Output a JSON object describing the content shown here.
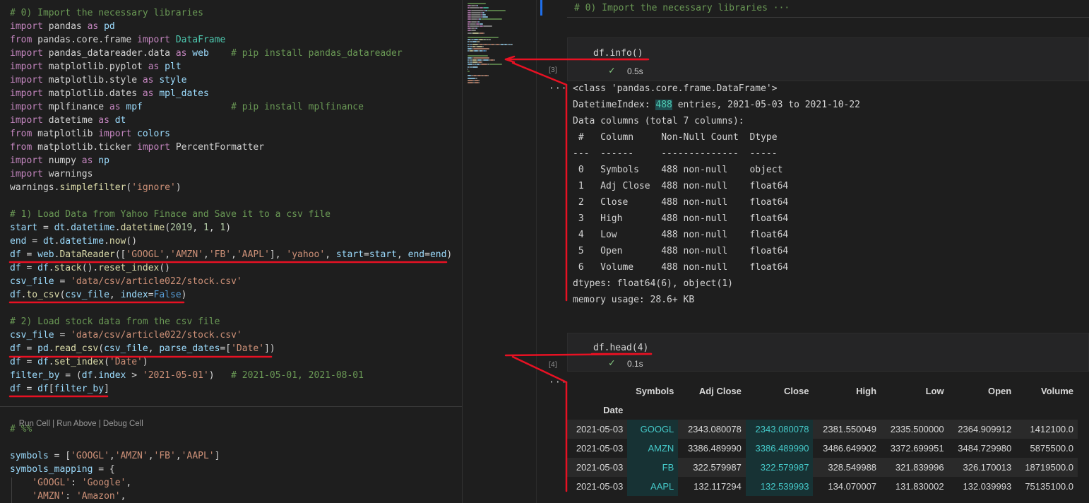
{
  "editor": {
    "lines": [
      [
        [
          "# 0) Import the necessary libraries",
          "cm"
        ]
      ],
      [
        [
          "import",
          "kw"
        ],
        [
          " pandas ",
          "def"
        ],
        [
          "as",
          "kw"
        ],
        [
          " pd",
          "var"
        ]
      ],
      [
        [
          "from",
          "kw"
        ],
        [
          " pandas.core.frame ",
          "def"
        ],
        [
          "import",
          "kw"
        ],
        [
          " DataFrame",
          "mod"
        ]
      ],
      [
        [
          "import",
          "kw"
        ],
        [
          " pandas_datareader.data ",
          "def"
        ],
        [
          "as",
          "kw"
        ],
        [
          " web",
          "var"
        ],
        [
          "    # pip install pandas_datareader",
          "cm"
        ]
      ],
      [
        [
          "import",
          "kw"
        ],
        [
          " matplotlib.pyplot ",
          "def"
        ],
        [
          "as",
          "kw"
        ],
        [
          " plt",
          "var"
        ]
      ],
      [
        [
          "import",
          "kw"
        ],
        [
          " matplotlib.style ",
          "def"
        ],
        [
          "as",
          "kw"
        ],
        [
          " style",
          "var"
        ]
      ],
      [
        [
          "import",
          "kw"
        ],
        [
          " matplotlib.dates ",
          "def"
        ],
        [
          "as",
          "kw"
        ],
        [
          " mpl_dates",
          "var"
        ]
      ],
      [
        [
          "import",
          "kw"
        ],
        [
          " mplfinance ",
          "def"
        ],
        [
          "as",
          "kw"
        ],
        [
          " mpf",
          "var"
        ],
        [
          "                # pip install mplfinance",
          "cm"
        ]
      ],
      [
        [
          "import",
          "kw"
        ],
        [
          " datetime ",
          "def"
        ],
        [
          "as",
          "kw"
        ],
        [
          " dt",
          "var"
        ]
      ],
      [
        [
          "from",
          "kw"
        ],
        [
          " matplotlib ",
          "def"
        ],
        [
          "import",
          "kw"
        ],
        [
          " colors",
          "var"
        ]
      ],
      [
        [
          "from",
          "kw"
        ],
        [
          " matplotlib.ticker ",
          "def"
        ],
        [
          "import",
          "kw"
        ],
        [
          " PercentFormatter",
          "def"
        ]
      ],
      [
        [
          "import",
          "kw"
        ],
        [
          " numpy ",
          "def"
        ],
        [
          "as",
          "kw"
        ],
        [
          " np",
          "var"
        ]
      ],
      [
        [
          "import",
          "kw"
        ],
        [
          " warnings",
          "def"
        ]
      ],
      [
        [
          "warnings",
          "def"
        ],
        [
          ".",
          "def"
        ],
        [
          "simplefilter",
          "fn"
        ],
        [
          "(",
          "def"
        ],
        [
          "'ignore'",
          "str"
        ],
        [
          ")",
          "def"
        ]
      ],
      [],
      [
        [
          "# 1) Load Data from Yahoo Finace and Save it to a csv file",
          "cm"
        ]
      ],
      [
        [
          "start",
          "var"
        ],
        [
          " = ",
          "def"
        ],
        [
          "dt",
          "var"
        ],
        [
          ".",
          "def"
        ],
        [
          "datetime",
          "var"
        ],
        [
          ".",
          "def"
        ],
        [
          "datetime",
          "fn"
        ],
        [
          "(",
          "def"
        ],
        [
          "2019",
          "num"
        ],
        [
          ", ",
          "def"
        ],
        [
          "1",
          "num"
        ],
        [
          ", ",
          "def"
        ],
        [
          "1",
          "num"
        ],
        [
          ")",
          "def"
        ]
      ],
      [
        [
          "end",
          "var"
        ],
        [
          " = ",
          "def"
        ],
        [
          "dt",
          "var"
        ],
        [
          ".",
          "def"
        ],
        [
          "datetime",
          "var"
        ],
        [
          ".",
          "def"
        ],
        [
          "now",
          "fn"
        ],
        [
          "()",
          "def"
        ]
      ],
      [
        [
          "df",
          "var"
        ],
        [
          " = ",
          "def"
        ],
        [
          "web",
          "var"
        ],
        [
          ".",
          "def"
        ],
        [
          "DataReader",
          "fn"
        ],
        [
          "([",
          "def"
        ],
        [
          "'GOOGL'",
          "str"
        ],
        [
          ",",
          "def"
        ],
        [
          "'AMZN'",
          "str"
        ],
        [
          ",",
          "def"
        ],
        [
          "'FB'",
          "str"
        ],
        [
          ",",
          "def"
        ],
        [
          "'AAPL'",
          "str"
        ],
        [
          "], ",
          "def"
        ],
        [
          "'yahoo'",
          "str"
        ],
        [
          ", ",
          "def"
        ],
        [
          "start",
          "var"
        ],
        [
          "=",
          "def"
        ],
        [
          "start",
          "var"
        ],
        [
          ", ",
          "def"
        ],
        [
          "end",
          "var"
        ],
        [
          "=",
          "def"
        ],
        [
          "end",
          "var"
        ],
        [
          ")",
          "def"
        ]
      ],
      [
        [
          "df",
          "var"
        ],
        [
          " = ",
          "def"
        ],
        [
          "df",
          "var"
        ],
        [
          ".",
          "def"
        ],
        [
          "stack",
          "fn"
        ],
        [
          "().",
          "def"
        ],
        [
          "reset_index",
          "fn"
        ],
        [
          "()",
          "def"
        ]
      ],
      [
        [
          "csv_file",
          "var"
        ],
        [
          " = ",
          "def"
        ],
        [
          "'data/csv/article022/stock.csv'",
          "str"
        ]
      ],
      [
        [
          "df",
          "var"
        ],
        [
          ".",
          "def"
        ],
        [
          "to_csv",
          "fn"
        ],
        [
          "(",
          "def"
        ],
        [
          "csv_file",
          "var"
        ],
        [
          ", ",
          "def"
        ],
        [
          "index",
          "var"
        ],
        [
          "=",
          "def"
        ],
        [
          "False",
          "bool"
        ],
        [
          ")",
          "def"
        ]
      ],
      [],
      [
        [
          "# 2) Load stock data from the csv file",
          "cm"
        ]
      ],
      [
        [
          "csv_file",
          "var"
        ],
        [
          " = ",
          "def"
        ],
        [
          "'data/csv/article022/stock.csv'",
          "str"
        ]
      ],
      [
        [
          "df",
          "var"
        ],
        [
          " = ",
          "def"
        ],
        [
          "pd",
          "var"
        ],
        [
          ".",
          "def"
        ],
        [
          "read_csv",
          "fn"
        ],
        [
          "(",
          "def"
        ],
        [
          "csv_file",
          "var"
        ],
        [
          ", ",
          "def"
        ],
        [
          "parse_dates",
          "var"
        ],
        [
          "=[",
          "def"
        ],
        [
          "'Date'",
          "str"
        ],
        [
          "])",
          "def"
        ]
      ],
      [
        [
          "df",
          "var"
        ],
        [
          " = ",
          "def"
        ],
        [
          "df",
          "var"
        ],
        [
          ".",
          "def"
        ],
        [
          "set_index",
          "fn"
        ],
        [
          "(",
          "def"
        ],
        [
          "'Date'",
          "str"
        ],
        [
          ")",
          "def"
        ]
      ],
      [
        [
          "filter_by",
          "var"
        ],
        [
          " = (",
          "def"
        ],
        [
          "df",
          "var"
        ],
        [
          ".",
          "def"
        ],
        [
          "index",
          "var"
        ],
        [
          " > ",
          "def"
        ],
        [
          "'2021-05-01'",
          "str"
        ],
        [
          ")   ",
          "def"
        ],
        [
          "# 2021-05-01, 2021-08-01",
          "cm"
        ]
      ],
      [
        [
          "df",
          "var"
        ],
        [
          " = ",
          "def"
        ],
        [
          "df",
          "var"
        ],
        [
          "[",
          "def"
        ],
        [
          "filter_by",
          "var"
        ],
        [
          "]",
          "def"
        ]
      ]
    ],
    "code_lens": "Run Cell | Run Above | Debug Cell",
    "lines2": [
      [
        [
          "# %%",
          "cm"
        ]
      ],
      [],
      [
        [
          "symbols",
          "var"
        ],
        [
          " = [",
          "def"
        ],
        [
          "'GOOGL'",
          "str"
        ],
        [
          ",",
          "def"
        ],
        [
          "'AMZN'",
          "str"
        ],
        [
          ",",
          "def"
        ],
        [
          "'FB'",
          "str"
        ],
        [
          ",",
          "def"
        ],
        [
          "'AAPL'",
          "str"
        ],
        [
          "]",
          "def"
        ]
      ],
      [
        [
          "symbols_mapping",
          "var"
        ],
        [
          " = {",
          "def"
        ]
      ],
      [
        [
          "    'GOOGL'",
          "str"
        ],
        [
          ": ",
          "def"
        ],
        [
          "'Google'",
          "str"
        ],
        [
          ",",
          "def"
        ]
      ],
      [
        [
          "    'AMZN'",
          "str"
        ],
        [
          ": ",
          "def"
        ],
        [
          "'Amazon'",
          "str"
        ],
        [
          ",",
          "def"
        ]
      ]
    ]
  },
  "notebook": {
    "markdown_cell": "# 0) Import the necessary libraries ···",
    "cell_info": {
      "code": "df.info()",
      "count": "[3]",
      "time": "0.5s",
      "check": "✓",
      "dots": "···"
    },
    "info_output": [
      "<class 'pandas.core.frame.DataFrame'>",
      "DatetimeIndex: |488| entries, 2021-05-03 to 2021-10-22",
      "Data columns (total 7 columns):",
      " #   Column     Non-Null Count  Dtype  ",
      "---  ------     --------------  -----  ",
      " 0   Symbols    488 non-null    object ",
      " 1   Adj Close  488 non-null    float64",
      " 2   Close      488 non-null    float64",
      " 3   High       488 non-null    float64",
      " 4   Low        488 non-null    float64",
      " 5   Open       488 non-null    float64",
      " 6   Volume     488 non-null    float64",
      "dtypes: float64(6), object(1)",
      "memory usage: 28.6+ KB"
    ],
    "cell_head": {
      "code": "df.head(4)",
      "count": "[4]",
      "time": "0.1s",
      "check": "✓",
      "dots": "···"
    },
    "table": {
      "columns": [
        "Symbols",
        "Adj Close",
        "Close",
        "High",
        "Low",
        "Open",
        "Volume"
      ],
      "index_name": "Date",
      "rows": [
        [
          "2021-05-03",
          "GOOGL",
          "2343.080078",
          "2343.080078",
          "2381.550049",
          "2335.500000",
          "2364.909912",
          "1412100.0"
        ],
        [
          "2021-05-03",
          "AMZN",
          "3386.489990",
          "3386.489990",
          "3486.649902",
          "3372.699951",
          "3484.729980",
          "5875500.0"
        ],
        [
          "2021-05-03",
          "FB",
          "322.579987",
          "322.579987",
          "328.549988",
          "321.839996",
          "326.170013",
          "18719500.0"
        ],
        [
          "2021-05-03",
          "AAPL",
          "132.117294",
          "132.539993",
          "134.070007",
          "131.830002",
          "132.039993",
          "75135100.0"
        ]
      ]
    }
  },
  "colors": {
    "annotation": "#e81123",
    "accent": "#1f6feb",
    "check": "#89d185"
  }
}
